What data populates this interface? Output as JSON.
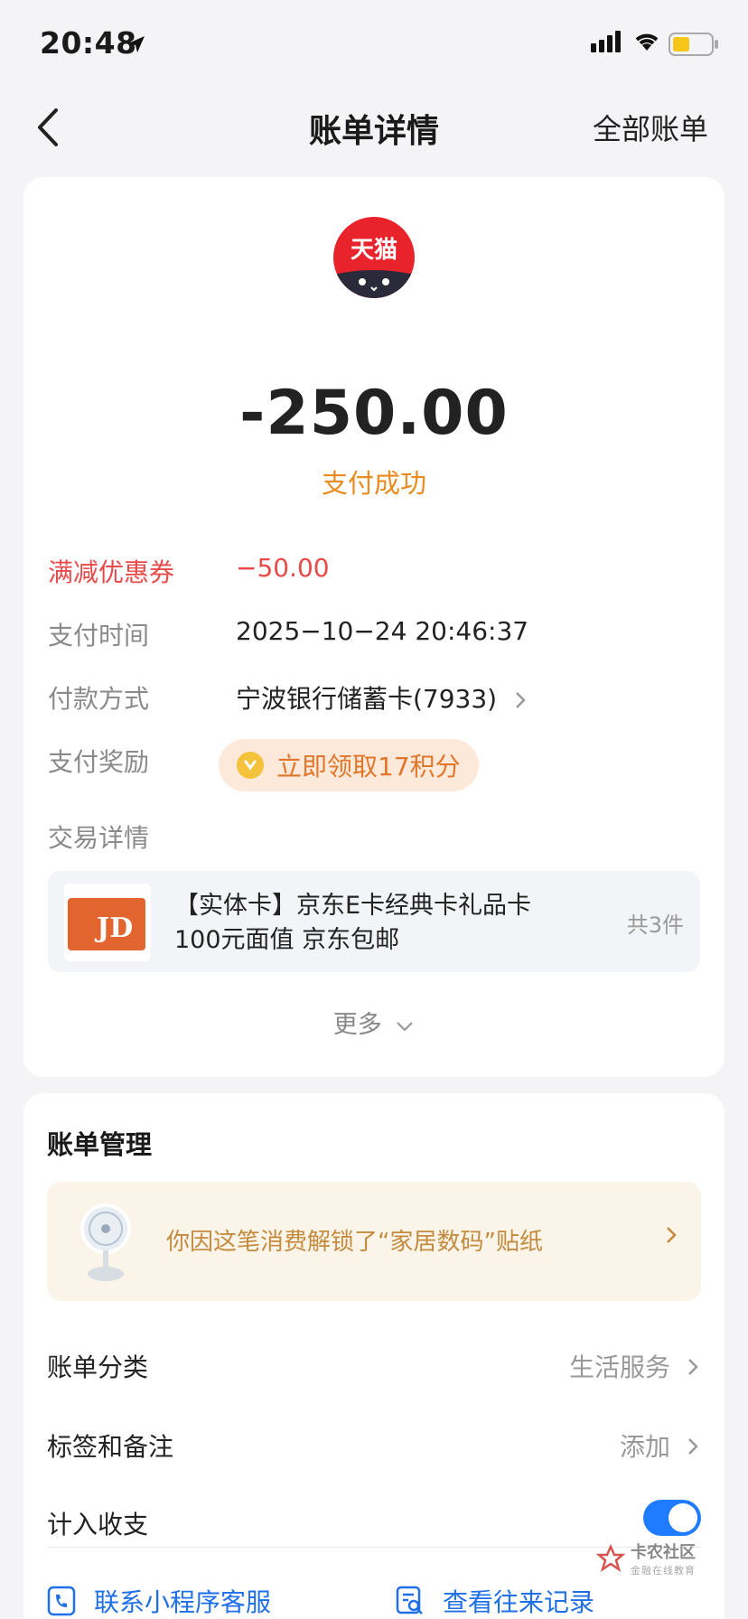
{
  "status_bar": {
    "time": "20:48"
  },
  "nav": {
    "title": "账单详情",
    "right_label": "全部账单"
  },
  "merchant": {
    "logo_text": "天猫",
    "name": ""
  },
  "payment": {
    "amount": "-250.00",
    "status": "支付成功",
    "rows": [
      {
        "label": "满减优惠券",
        "value": "−50.00"
      },
      {
        "label": "支付时间",
        "value": "2025−10−24 20:46:37"
      },
      {
        "label": "付款方式",
        "value": "宁波银行储蓄卡(7933)"
      },
      {
        "label": "支付奖励",
        "value": ""
      }
    ],
    "reward_text": "立即领取17积分"
  },
  "transaction": {
    "section_label": "交易详情",
    "product_title": "【实体卡】京东E卡经典卡礼品卡100元面值 京东包邮",
    "product_qty": "共3件",
    "more_label": "更多"
  },
  "management": {
    "title": "账单管理",
    "sticker_text": "你因这笔消费解锁了“家居数码”贴纸",
    "category_label": "账单分类",
    "category_value": "生活服务",
    "tags_label": "标签和备注",
    "tags_value": "添加",
    "include_label": "计入收支",
    "include_enabled": true
  },
  "actions": {
    "contact_label": "联系小程序客服",
    "history_label": "查看往来记录"
  },
  "watermark": {
    "main": "卡农社区",
    "sub": "金融在线教育"
  },
  "colors": {
    "accent_blue": "#1f7bff",
    "status_orange": "#e98b1f",
    "discount_red": "#e84a4a",
    "tmall_red": "#e8232c"
  }
}
